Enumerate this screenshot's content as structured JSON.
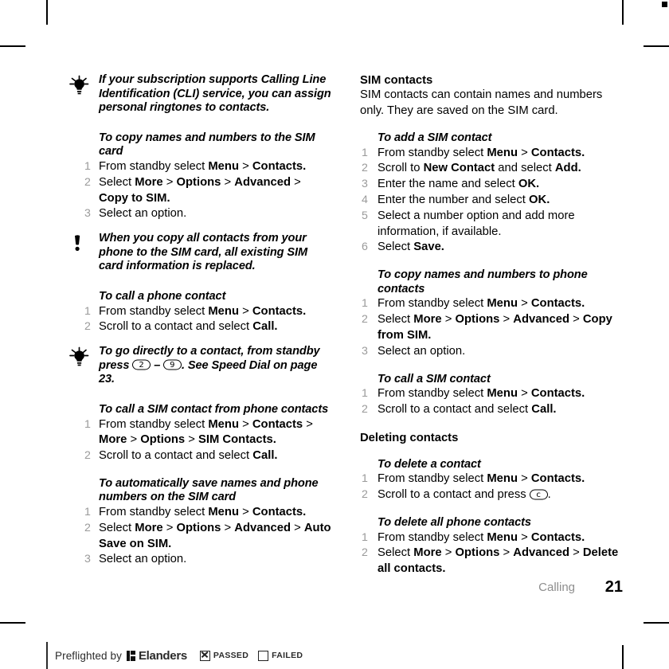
{
  "document": {
    "chapter": "Calling",
    "page_number": "21"
  },
  "left_column": {
    "tip1": {
      "icon": "lightbulb-icon",
      "text": "If your subscription supports Calling Line Identification (CLI) service, you can assign personal ringtones to contacts."
    },
    "proc_copy_to_sim": {
      "heading": "To copy names and numbers to the SIM card",
      "steps": [
        {
          "parts": [
            {
              "t": "From standby select ",
              "b": false
            },
            {
              "t": "Menu",
              "b": true
            },
            {
              "t": " > ",
              "b": false
            },
            {
              "t": "Contacts.",
              "b": true
            }
          ]
        },
        {
          "parts": [
            {
              "t": "Select ",
              "b": false
            },
            {
              "t": "More",
              "b": true
            },
            {
              "t": " > ",
              "b": false
            },
            {
              "t": "Options",
              "b": true
            },
            {
              "t": " > ",
              "b": false
            },
            {
              "t": "Advanced",
              "b": true
            },
            {
              "t": " > ",
              "b": false
            },
            {
              "t": "Copy to SIM.",
              "b": true
            }
          ]
        },
        {
          "parts": [
            {
              "t": "Select an option.",
              "b": false
            }
          ]
        }
      ]
    },
    "note1": {
      "icon": "exclamation-icon",
      "text": "When you copy all contacts from your phone to the SIM card, all existing SIM card information is replaced."
    },
    "proc_call_phone_contact": {
      "heading": "To call a phone contact",
      "steps": [
        {
          "parts": [
            {
              "t": "From standby select ",
              "b": false
            },
            {
              "t": "Menu",
              "b": true
            },
            {
              "t": " > ",
              "b": false
            },
            {
              "t": "Contacts.",
              "b": true
            }
          ]
        },
        {
          "parts": [
            {
              "t": "Scroll to a contact and select ",
              "b": false
            },
            {
              "t": "Call.",
              "b": true
            }
          ]
        }
      ]
    },
    "tip2": {
      "icon": "lightbulb-icon",
      "text_before": "To go directly to a contact, from standby press ",
      "key_from": "2",
      "dash": " – ",
      "key_to": "9",
      "text_after": ". See Speed Dial on page 23."
    },
    "proc_call_sim_from_phone": {
      "heading": "To call a SIM contact from phone contacts",
      "steps": [
        {
          "parts": [
            {
              "t": "From standby select ",
              "b": false
            },
            {
              "t": "Menu",
              "b": true
            },
            {
              "t": " > ",
              "b": false
            },
            {
              "t": "Contacts",
              "b": true
            },
            {
              "t": " > ",
              "b": false
            },
            {
              "t": "More",
              "b": true
            },
            {
              "t": " > ",
              "b": false
            },
            {
              "t": "Options",
              "b": true
            },
            {
              "t": " > ",
              "b": false
            },
            {
              "t": "SIM Contacts.",
              "b": true
            }
          ]
        },
        {
          "parts": [
            {
              "t": "Scroll to a contact and select ",
              "b": false
            },
            {
              "t": "Call.",
              "b": true
            }
          ]
        }
      ]
    },
    "proc_auto_save": {
      "heading": "To automatically save names and phone numbers on the SIM card",
      "steps": [
        {
          "parts": [
            {
              "t": "From standby select ",
              "b": false
            },
            {
              "t": "Menu",
              "b": true
            },
            {
              "t": " > ",
              "b": false
            },
            {
              "t": "Contacts.",
              "b": true
            }
          ]
        },
        {
          "parts": [
            {
              "t": "Select ",
              "b": false
            },
            {
              "t": "More",
              "b": true
            },
            {
              "t": " > ",
              "b": false
            },
            {
              "t": "Options",
              "b": true
            },
            {
              "t": " > ",
              "b": false
            },
            {
              "t": "Advanced",
              "b": true
            },
            {
              "t": " > ",
              "b": false
            },
            {
              "t": "Auto Save on SIM.",
              "b": true
            }
          ]
        },
        {
          "parts": [
            {
              "t": "Select an option.",
              "b": false
            }
          ]
        }
      ]
    }
  },
  "right_column": {
    "section_sim_contacts": {
      "heading": "SIM contacts",
      "body": "SIM contacts can contain names and numbers only. They are saved on the SIM card."
    },
    "proc_add_sim_contact": {
      "heading": "To add a SIM contact",
      "steps": [
        {
          "parts": [
            {
              "t": "From standby select ",
              "b": false
            },
            {
              "t": "Menu",
              "b": true
            },
            {
              "t": " > ",
              "b": false
            },
            {
              "t": "Contacts.",
              "b": true
            }
          ]
        },
        {
          "parts": [
            {
              "t": "Scroll to ",
              "b": false
            },
            {
              "t": "New Contact",
              "b": true
            },
            {
              "t": " and select ",
              "b": false
            },
            {
              "t": "Add.",
              "b": true
            }
          ]
        },
        {
          "parts": [
            {
              "t": "Enter the name and select ",
              "b": false
            },
            {
              "t": "OK.",
              "b": true
            }
          ]
        },
        {
          "parts": [
            {
              "t": "Enter the number and select ",
              "b": false
            },
            {
              "t": "OK.",
              "b": true
            }
          ]
        },
        {
          "parts": [
            {
              "t": "Select a number option and add more information, if available.",
              "b": false
            }
          ]
        },
        {
          "parts": [
            {
              "t": "Select ",
              "b": false
            },
            {
              "t": "Save.",
              "b": true
            }
          ]
        }
      ]
    },
    "proc_copy_from_sim": {
      "heading": "To copy names and numbers to phone contacts",
      "steps": [
        {
          "parts": [
            {
              "t": "From standby select ",
              "b": false
            },
            {
              "t": "Menu",
              "b": true
            },
            {
              "t": " > ",
              "b": false
            },
            {
              "t": "Contacts.",
              "b": true
            }
          ]
        },
        {
          "parts": [
            {
              "t": "Select ",
              "b": false
            },
            {
              "t": "More",
              "b": true
            },
            {
              "t": " > ",
              "b": false
            },
            {
              "t": "Options",
              "b": true
            },
            {
              "t": " > ",
              "b": false
            },
            {
              "t": "Advanced",
              "b": true
            },
            {
              "t": " > ",
              "b": false
            },
            {
              "t": "Copy from SIM.",
              "b": true
            }
          ]
        },
        {
          "parts": [
            {
              "t": "Select an option.",
              "b": false
            }
          ]
        }
      ]
    },
    "proc_call_sim_contact": {
      "heading": "To call a SIM contact",
      "steps": [
        {
          "parts": [
            {
              "t": "From standby select ",
              "b": false
            },
            {
              "t": "Menu",
              "b": true
            },
            {
              "t": " > ",
              "b": false
            },
            {
              "t": "Contacts.",
              "b": true
            }
          ]
        },
        {
          "parts": [
            {
              "t": "Scroll to a contact and select ",
              "b": false
            },
            {
              "t": "Call.",
              "b": true
            }
          ]
        }
      ]
    },
    "section_deleting": {
      "heading": "Deleting contacts"
    },
    "proc_delete_contact": {
      "heading": "To delete a contact",
      "steps": [
        {
          "parts": [
            {
              "t": "From standby select ",
              "b": false
            },
            {
              "t": "Menu",
              "b": true
            },
            {
              "t": " > ",
              "b": false
            },
            {
              "t": "Contacts.",
              "b": true
            }
          ]
        },
        {
          "parts": [
            {
              "t": "Scroll to a contact and press ",
              "b": false
            },
            {
              "key": "c"
            },
            {
              "t": ".",
              "b": false
            }
          ]
        }
      ]
    },
    "proc_delete_all": {
      "heading": "To delete all phone contacts",
      "steps": [
        {
          "parts": [
            {
              "t": "From standby select ",
              "b": false
            },
            {
              "t": "Menu",
              "b": true
            },
            {
              "t": " > ",
              "b": false
            },
            {
              "t": "Contacts.",
              "b": true
            }
          ]
        },
        {
          "parts": [
            {
              "t": "Select ",
              "b": false
            },
            {
              "t": "More",
              "b": true
            },
            {
              "t": " > ",
              "b": false
            },
            {
              "t": "Options",
              "b": true
            },
            {
              "t": " > ",
              "b": false
            },
            {
              "t": "Advanced",
              "b": true
            },
            {
              "t": " > ",
              "b": false
            },
            {
              "t": "Delete all contacts.",
              "b": true
            }
          ]
        }
      ]
    }
  },
  "preflight": {
    "prefix": "Preflighted by",
    "company": "Elanders",
    "passed_label": "PASSED",
    "failed_label": "FAILED",
    "passed_checked": true,
    "failed_checked": false
  }
}
